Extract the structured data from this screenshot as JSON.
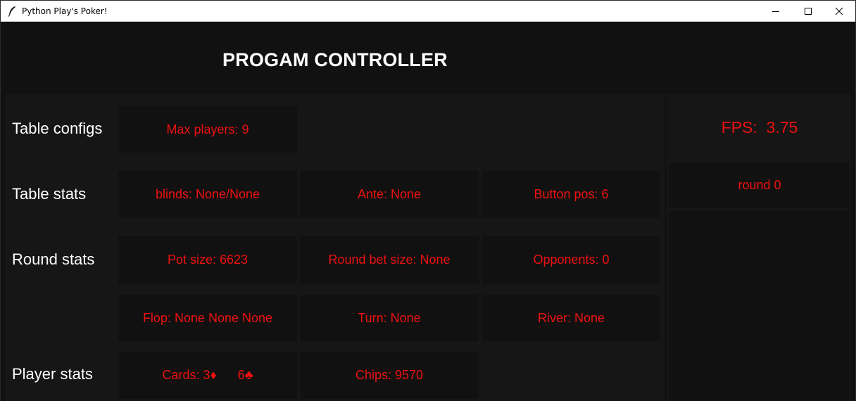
{
  "window": {
    "title": "Python Play's Poker!"
  },
  "heading": "PROGAM CONTROLLER",
  "labels": {
    "table_configs": "Table configs",
    "table_stats": "Table stats",
    "round_stats": "Round stats",
    "player_stats": "Player stats"
  },
  "table_configs": {
    "max_players": "Max players: 9"
  },
  "table_stats": {
    "blinds": "blinds: None/None",
    "ante": "Ante: None",
    "button_pos": "Button pos: 6"
  },
  "round_stats": {
    "pot_size": "Pot size: 6623",
    "round_bet_size": "Round bet size: None",
    "opponents": "Opponents: 0",
    "flop": "Flop: None None None",
    "turn": "Turn: None",
    "river": "River: None"
  },
  "player_stats": {
    "cards": "Cards: 3♦      6♣",
    "chips": "Chips: 9570"
  },
  "side": {
    "fps": "FPS:  3.75",
    "round": "round 0"
  },
  "colors": {
    "value_text": "#ee1111",
    "background": "#111111",
    "panel": "#161616"
  }
}
